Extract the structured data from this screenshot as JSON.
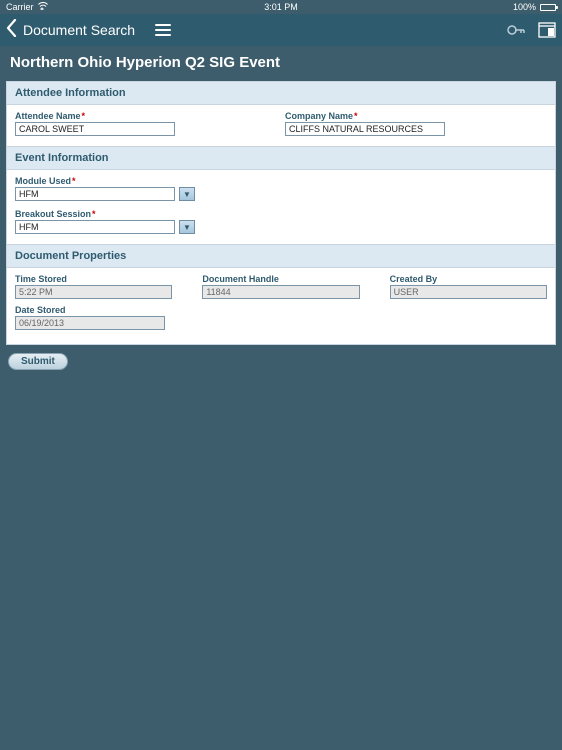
{
  "status": {
    "carrier": "Carrier",
    "time": "3:01 PM",
    "battery": "100%"
  },
  "nav": {
    "back_label": "Document Search"
  },
  "page_title": "Northern Ohio Hyperion Q2 SIG Event",
  "sections": {
    "attendee": {
      "header": "Attendee Information",
      "attendee_name_label": "Attendee Name",
      "attendee_name_value": "CAROL SWEET",
      "company_name_label": "Company Name",
      "company_name_value": "CLIFFS NATURAL RESOURCES"
    },
    "event": {
      "header": "Event Information",
      "module_used_label": "Module Used",
      "module_used_value": "HFM",
      "breakout_label": "Breakout Session",
      "breakout_value": "HFM"
    },
    "docprops": {
      "header": "Document Properties",
      "time_stored_label": "Time Stored",
      "time_stored_value": "5:22 PM",
      "handle_label": "Document Handle",
      "handle_value": "11844",
      "created_by_label": "Created By",
      "created_by_value": "USER",
      "date_stored_label": "Date Stored",
      "date_stored_value": "06/19/2013"
    }
  },
  "submit_label": "Submit"
}
